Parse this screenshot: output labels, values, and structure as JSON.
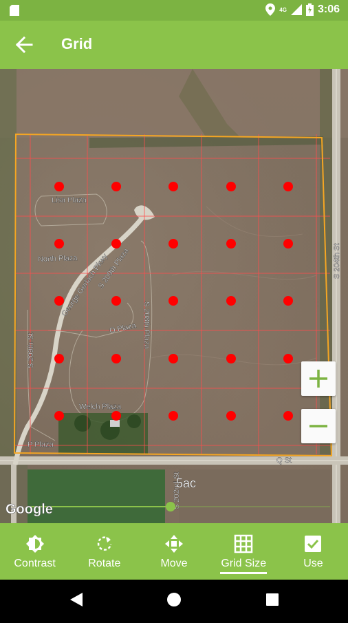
{
  "status_bar": {
    "time": "3:06",
    "network": "4G"
  },
  "app_bar": {
    "title": "Grid",
    "back_icon": "arrow-back-icon"
  },
  "map": {
    "roads": [
      {
        "label": "Lisa Plaza"
      },
      {
        "label": "North Plaza"
      },
      {
        "label": "George Gerlach Pkwy"
      },
      {
        "label": "S 209th Plaza"
      },
      {
        "label": "O Plaza"
      },
      {
        "label": "S 208th Plaza"
      },
      {
        "label": "S 209th St"
      },
      {
        "label": "Welch Plaza"
      },
      {
        "label": "P Plaza"
      },
      {
        "label": "S 202nd St"
      },
      {
        "label": "S 204th St"
      },
      {
        "label": "Q St"
      }
    ],
    "acreage_label": "5ac",
    "attribution": "Google",
    "grid_slider_value": 0.5,
    "colors": {
      "boundary": "#f5a623",
      "grid_lines": "#ff4d4d",
      "points": "#ff0000"
    }
  },
  "zoom": {
    "zoom_in_icon": "plus-icon",
    "zoom_out_icon": "minus-icon"
  },
  "toolbar": {
    "items": [
      {
        "label": "Contrast",
        "icon": "contrast-icon"
      },
      {
        "label": "Rotate",
        "icon": "rotate-icon"
      },
      {
        "label": "Move",
        "icon": "move-icon"
      },
      {
        "label": "Grid Size",
        "icon": "grid-icon",
        "selected": true
      },
      {
        "label": "Use",
        "icon": "check-icon"
      }
    ]
  },
  "colors": {
    "primary": "#8bc34a",
    "status_bar": "#7cb342"
  }
}
